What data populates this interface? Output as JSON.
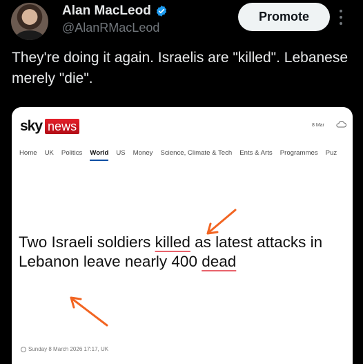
{
  "author": {
    "display_name": "Alan MacLeod",
    "handle": "@AlanRMacLeod",
    "verified": true
  },
  "actions": {
    "promote_label": "Promote",
    "more_icon": "more-vertical-icon"
  },
  "tweet": {
    "text": "They're doing it again. Israelis are \"killed\". Lebanese merely \"die\"."
  },
  "article": {
    "brand_sky": "sky",
    "brand_news": "news",
    "date_chip": "8 Mar",
    "weather_icon": "cloud-icon",
    "nav": [
      "Home",
      "UK",
      "Politics",
      "World",
      "US",
      "Money",
      "Science, Climate & Tech",
      "Ents & Arts",
      "Programmes",
      "Puz"
    ],
    "active_nav": "World",
    "headline": {
      "part1": "Two Israeli soldiers ",
      "killed": "killed",
      "part2": " as latest attacks in Lebanon leave nearly 400 ",
      "dead": "dead"
    },
    "timestamp": "Sunday 8 March 2026 17:17, UK"
  },
  "colors": {
    "accent_red": "#e8626b",
    "arrow_orange": "#f26522",
    "verified_blue": "#1d9bf0",
    "sky_red": "#e4202a"
  }
}
